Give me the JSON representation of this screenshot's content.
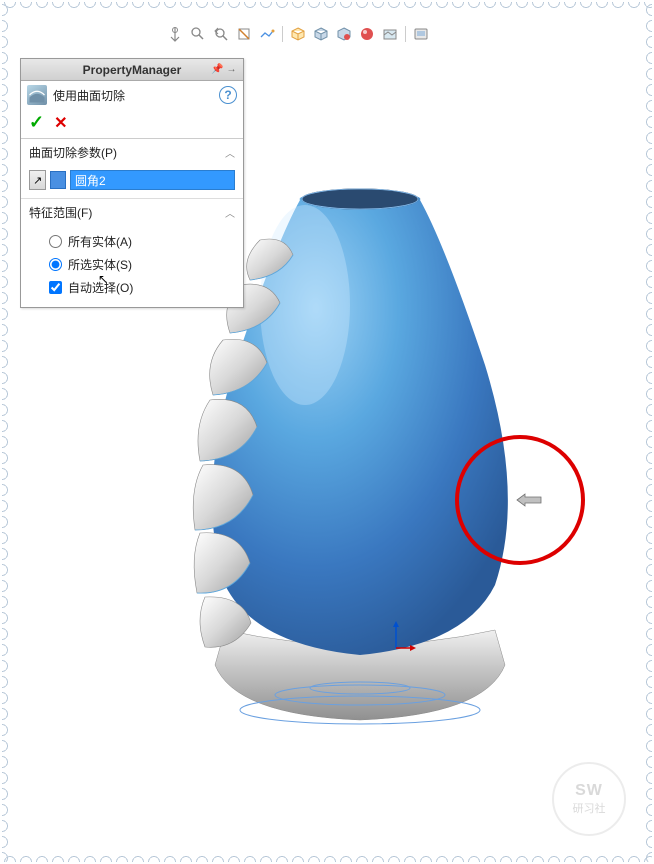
{
  "panel": {
    "title": "PropertyManager",
    "feature_title": "使用曲面切除",
    "section1": {
      "label": "曲面切除参数(P)",
      "selected": "圆角2"
    },
    "section2": {
      "label": "特征范围(F)",
      "opt_all": "所有实体(A)",
      "opt_selected": "所选实体(S)",
      "opt_auto": "自动选择(O)"
    }
  },
  "watermark": {
    "line1": "SW",
    "line2": "研习社"
  }
}
